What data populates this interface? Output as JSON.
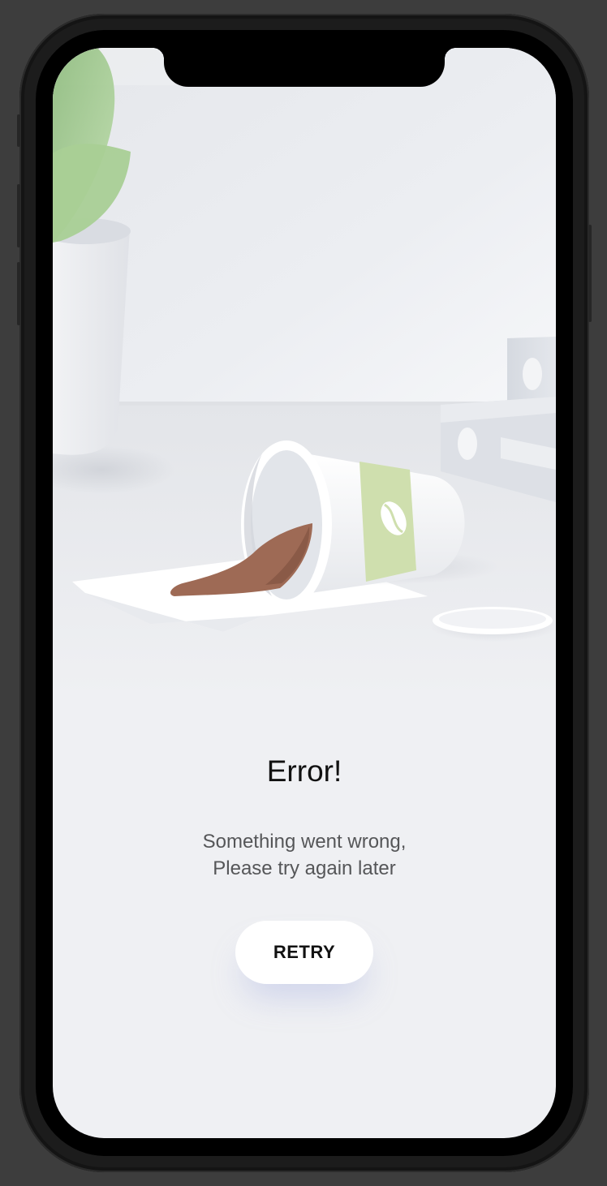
{
  "error": {
    "title": "Error!",
    "message_line1": "Something went wrong,",
    "message_line2": "Please try again later",
    "retry_label": "RETRY"
  },
  "colors": {
    "screen_background": "#eff0f3",
    "button_background": "#ffffff",
    "cup_sleeve": "#cfdfae",
    "coffee": "#9e6a55",
    "leaf": "#a6cc93"
  },
  "icons": {
    "cup_logo": "coffee-bean-icon"
  }
}
